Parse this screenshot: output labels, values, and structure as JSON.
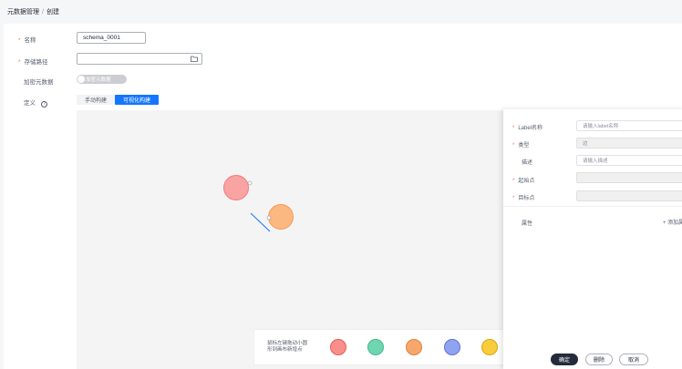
{
  "breadcrumb": {
    "parent": "元数据管理",
    "separator": "/",
    "current": "创建"
  },
  "form": {
    "name": {
      "label": "名称",
      "value": "schema_0001"
    },
    "path": {
      "label": "存储路径",
      "value": ""
    },
    "encrypt": {
      "label": "加密元数据",
      "toggle_text": "加密元数据"
    },
    "define": {
      "label": "定义",
      "help": "?",
      "tabs": [
        "手动构建",
        "可视化构建"
      ],
      "active_tab": "可视化构建"
    }
  },
  "palette": {
    "hint_line1": "鼠标左键拖动小圆",
    "hint_line2": "形到画布新增点",
    "colors": [
      "#f98e8a",
      "#6fd6b1",
      "#f8a76a",
      "#8fa3f0",
      "#f8cc3a"
    ]
  },
  "graph": {
    "node_colors": [
      "#f9a3a3",
      "#fbb880"
    ],
    "edge_color": "#1476ff"
  },
  "panel": {
    "label_name": {
      "label": "Label名称",
      "placeholder": "请输入label名称"
    },
    "type": {
      "label": "类型",
      "value": "边"
    },
    "description": {
      "label": "描述",
      "placeholder": "请输入描述"
    },
    "source": {
      "label": "起始点",
      "value": ""
    },
    "target": {
      "label": "目标点",
      "value": ""
    },
    "attributes": {
      "label": "属性",
      "add_label": "+ 添加属性"
    },
    "buttons": {
      "confirm": "确定",
      "delete": "删除",
      "cancel": "取消"
    }
  }
}
